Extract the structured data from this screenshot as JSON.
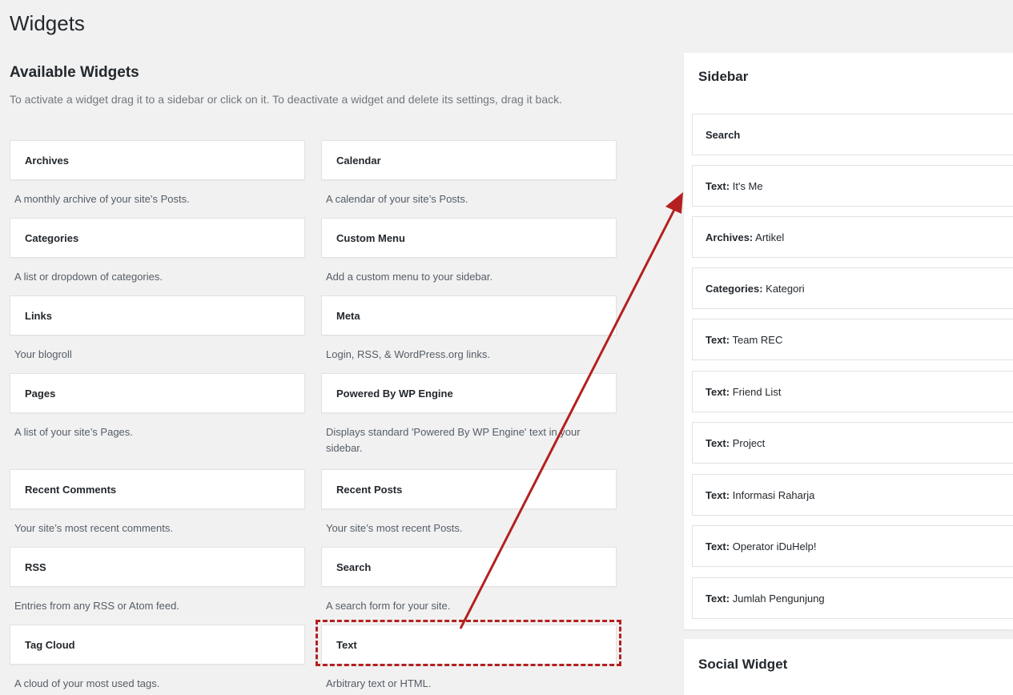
{
  "page": {
    "title": "Widgets"
  },
  "available": {
    "heading": "Available Widgets",
    "description": "To activate a widget drag it to a sidebar or click on it. To deactivate a widget and delete its settings, drag it back.",
    "left": [
      {
        "name": "Archives",
        "desc": "A monthly archive of your site’s Posts."
      },
      {
        "name": "Categories",
        "desc": "A list or dropdown of categories."
      },
      {
        "name": "Links",
        "desc": "Your blogroll"
      },
      {
        "name": "Pages",
        "desc": "A list of your site’s Pages."
      },
      {
        "name": "Recent Comments",
        "desc": "Your site’s most recent comments."
      },
      {
        "name": "RSS",
        "desc": "Entries from any RSS or Atom feed."
      },
      {
        "name": "Tag Cloud",
        "desc": "A cloud of your most used tags."
      }
    ],
    "right": [
      {
        "name": "Calendar",
        "desc": "A calendar of your site’s Posts."
      },
      {
        "name": "Custom Menu",
        "desc": "Add a custom menu to your sidebar."
      },
      {
        "name": "Meta",
        "desc": "Login, RSS, & WordPress.org links."
      },
      {
        "name": "Powered By WP Engine",
        "desc": "Displays standard 'Powered By WP Engine' text in your sidebar."
      },
      {
        "name": "Recent Posts",
        "desc": "Your site’s most recent Posts."
      },
      {
        "name": "Search",
        "desc": "A search form for your site."
      },
      {
        "name": "Text",
        "desc": "Arbitrary text or HTML."
      }
    ]
  },
  "sidebar": {
    "title": "Sidebar",
    "widgets": [
      {
        "type": "Search",
        "title": ""
      },
      {
        "type": "Text:",
        "title": "It's Me"
      },
      {
        "type": "Archives:",
        "title": "Artikel"
      },
      {
        "type": "Categories:",
        "title": "Kategori"
      },
      {
        "type": "Text:",
        "title": "Team REC"
      },
      {
        "type": "Text:",
        "title": "Friend List"
      },
      {
        "type": "Text:",
        "title": "Project"
      },
      {
        "type": "Text:",
        "title": "Informasi Raharja"
      },
      {
        "type": "Text:",
        "title": "Operator iDuHelp!"
      },
      {
        "type": "Text:",
        "title": "Jumlah Pengunjung"
      }
    ]
  },
  "social": {
    "title": "Social Widget"
  },
  "colors": {
    "annotation": "#b3201f"
  }
}
